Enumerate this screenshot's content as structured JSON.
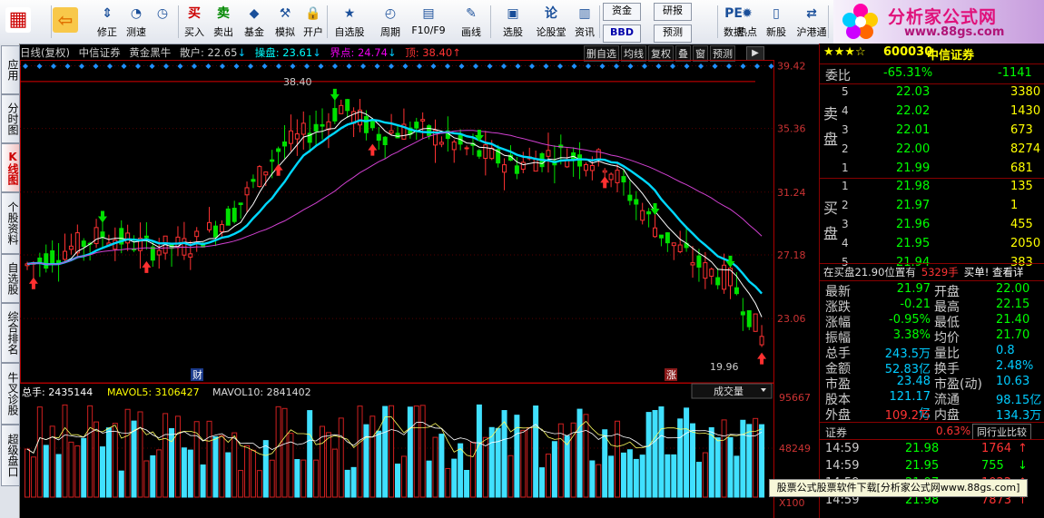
{
  "toolbar": {
    "items": [
      {
        "label": "",
        "icon": "grid-icon"
      },
      {
        "label": "",
        "icon": "back-arrow-icon"
      },
      {
        "label": "修正",
        "icon": "up-down-icon"
      },
      {
        "label": "测速",
        "icon": "gauge-icon"
      },
      {
        "label": "",
        "icon": "clock-icon"
      },
      {
        "label": "买入",
        "icon": "buy-icon",
        "glyph": "买"
      },
      {
        "label": "卖出",
        "icon": "sell-icon",
        "glyph": "卖"
      },
      {
        "label": "基金",
        "icon": "fund-icon"
      },
      {
        "label": "模拟",
        "icon": "hammer-icon"
      },
      {
        "label": "开户",
        "icon": "lock-icon"
      },
      {
        "label": "自选股",
        "icon": "star-icon"
      },
      {
        "label": "周期",
        "icon": "period-icon"
      },
      {
        "label": "F10/F9",
        "icon": "f10-icon"
      },
      {
        "label": "画线",
        "icon": "pen-icon"
      },
      {
        "label": "选股",
        "icon": "filter-icon"
      },
      {
        "label": "论股堂",
        "icon": "forum-icon"
      },
      {
        "label": "资讯",
        "icon": "news-icon"
      },
      {
        "label": "资金",
        "icon": "money-icon"
      },
      {
        "label": "BBD",
        "icon": "bbd-icon"
      },
      {
        "label": "研报",
        "icon": "report-icon"
      },
      {
        "label": "预测",
        "icon": "forecast-icon"
      },
      {
        "label": "数据",
        "icon": "pe-icon"
      },
      {
        "label": "热点",
        "icon": "hot-icon"
      },
      {
        "label": "新股",
        "icon": "newstock-icon"
      },
      {
        "label": "沪港通",
        "icon": "hk-icon"
      },
      {
        "label": "大盘",
        "icon": "index-icon"
      }
    ],
    "logo_title": "分析家公式网",
    "logo_url": "www.88gs.com"
  },
  "leftnav": [
    {
      "label": "应用"
    },
    {
      "label": "分时图"
    },
    {
      "label": "K线图",
      "active": true
    },
    {
      "label": "个股资料"
    },
    {
      "label": "自选股"
    },
    {
      "label": "综合排名"
    },
    {
      "label": "牛叉诊股"
    },
    {
      "label": "超级盘口"
    }
  ],
  "header": {
    "period": "日线(复权)",
    "stock": "中信证券",
    "indicator": "黄金黑牛",
    "sanhu": "散户: 22.65",
    "caopan": "操盘: 23.61",
    "jiedian": "界点: 24.74",
    "ding": "顶: 38.40",
    "buttons": [
      "删自选",
      "均线",
      "复权",
      "叠",
      "窗",
      "预测"
    ]
  },
  "chart_data": {
    "type": "candlestick",
    "title": "",
    "y_ticks": [
      39.42,
      35.36,
      31.24,
      27.18,
      23.06
    ],
    "ylim": [
      18.9,
      39.8
    ],
    "high_label": "38.40",
    "low_label": "19.96",
    "markers": [
      {
        "label": "财"
      },
      {
        "label": "涨"
      }
    ],
    "volume_ticks": [
      "95667",
      "48249",
      "X100"
    ],
    "volume_header": {
      "total": "总手: 2435144",
      "mavol5": "MAVOL5: 3106427",
      "mavol10": "MAVOL10: 2841402",
      "dropdown": "成交量"
    }
  },
  "right_panel": {
    "title": "中信证券",
    "code": "600030",
    "weibi_label": "委比",
    "weibi_pct": "-65.31%",
    "weibi_diff": "-1141",
    "sell_label": "卖盘",
    "buy_label": "买盘",
    "asks": [
      {
        "lvl": "5",
        "price": "22.03",
        "vol": "3380"
      },
      {
        "lvl": "4",
        "price": "22.02",
        "vol": "1430"
      },
      {
        "lvl": "3",
        "price": "22.01",
        "vol": "673"
      },
      {
        "lvl": "2",
        "price": "22.00",
        "vol": "8274"
      },
      {
        "lvl": "1",
        "price": "21.99",
        "vol": "681"
      }
    ],
    "bids": [
      {
        "lvl": "1",
        "price": "21.98",
        "vol": "135"
      },
      {
        "lvl": "2",
        "price": "21.97",
        "vol": "1"
      },
      {
        "lvl": "3",
        "price": "21.96",
        "vol": "455"
      },
      {
        "lvl": "4",
        "price": "21.95",
        "vol": "2050"
      },
      {
        "lvl": "5",
        "price": "21.94",
        "vol": "383"
      }
    ],
    "notice_pre": "在买盘21.90位置有",
    "notice_vol": "5329手",
    "notice_post": "买单! 查看详",
    "stats": [
      {
        "k1": "最新",
        "v1": "21.97",
        "k2": "开盘",
        "v2": "22.00"
      },
      {
        "k1": "涨跌",
        "v1": "-0.21",
        "k2": "最高",
        "v2": "22.15"
      },
      {
        "k1": "涨幅",
        "v1": "-0.95%",
        "k2": "最低",
        "v2": "21.40"
      },
      {
        "k1": "振幅",
        "v1": "3.38%",
        "k2": "均价",
        "v2": "21.70"
      },
      {
        "k1": "总手",
        "v1": "243.5万",
        "k2": "量比",
        "v2": "0.8"
      },
      {
        "k1": "金额",
        "v1": "52.83亿",
        "k2": "换手",
        "v2": "2.48%"
      },
      {
        "k1": "市盈",
        "v1": "23.48",
        "k2": "市盈(动)",
        "v2": "10.63"
      },
      {
        "k1": "股本",
        "v1": "121.17亿",
        "k2": "流通",
        "v2": "98.15亿"
      },
      {
        "k1": "外盘",
        "v1": "109.2万",
        "k2": "内盘",
        "v2": "134.3万"
      }
    ],
    "sector_label": "证券",
    "sector_pct": "0.63%",
    "sector_btn": "同行业比较",
    "ticks": [
      {
        "t": "14:59",
        "p": "21.98",
        "v": "1764",
        "dir": "up"
      },
      {
        "t": "14:59",
        "p": "21.95",
        "v": "755",
        "dir": "down"
      },
      {
        "t": "14:59",
        "p": "21.97",
        "v": "1022",
        "dir": "up"
      },
      {
        "t": "14:59",
        "p": "21.98",
        "v": "7873",
        "dir": "up"
      }
    ]
  },
  "watermark": "股票公式股票软件下载[分析家公式网www.88gs.com]"
}
